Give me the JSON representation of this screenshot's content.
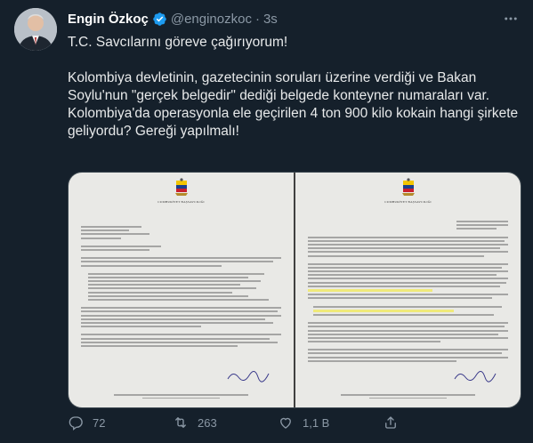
{
  "tweet": {
    "author_name": "Engin Özkoç",
    "handle": "@enginozkoc",
    "separator": "·",
    "time": "3s",
    "paragraphs": [
      "T.C. Savcılarını göreve çağırıyorum!",
      "Kolombiya devletinin, gazetecinin soruları üzerine verdiği ve Bakan Soylu'nun \"gerçek belgedir\" dediği belgede konteyner numaraları var. Kolombiya'da operasyonla ele geçirilen 4 ton 900 kilo kokain hangi şirkete geliyordu? Gereği yapılmalı!"
    ]
  },
  "media": {
    "page_caption": "CUMHURİYET BAŞSAVCILIĞI"
  },
  "actions": {
    "reply_count": "72",
    "retweet_count": "263",
    "like_count": "1,1 B"
  },
  "colors": {
    "background": "#15202b",
    "verified": "#1d9bf0",
    "highlight": "#f1ea55",
    "muted_text": "#8b98a5"
  },
  "icons": [
    "verified-badge-icon",
    "more-icon",
    "reply-icon",
    "retweet-icon",
    "like-icon",
    "share-icon",
    "colombia-emblem-icon"
  ]
}
